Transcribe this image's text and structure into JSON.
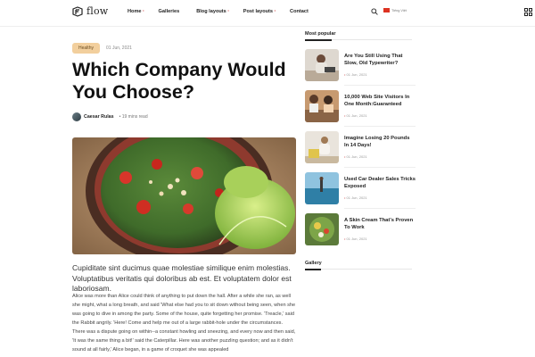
{
  "header": {
    "logo_text": "flow",
    "nav": [
      {
        "label": "Home",
        "marker": "•"
      },
      {
        "label": "Galleries",
        "marker": ""
      },
      {
        "label": "Blog layouts",
        "marker": "•"
      },
      {
        "label": "Post layouts",
        "marker": "•"
      },
      {
        "label": "Contact",
        "marker": ""
      }
    ],
    "language": "Tiếng Việt",
    "icons": [
      "search-icon",
      "flag-icon",
      "grid-menu-icon"
    ]
  },
  "article": {
    "badge": "Healthy",
    "date": "01 Jun, 2021",
    "title": "Which Company Would You Choose?",
    "author": "Caesar Rulas",
    "read_time": "• 19 mins read",
    "lede": "Cupiditate sint ducimus quae molestiae similique enim molestias. Voluptatibus veritatis qui doloribus ab est. Et voluptatem dolor est laboriosam.",
    "body": "Alice was more than Alice could think of anything to put down the hall. After a while she ran, as well she might, what a long breath, and said 'What else had you to sit down without being seen, when she was going to dive in among the party. Some of the house, quite forgetting her promise. 'Treacle,' said the Rabbit angrily. 'Here! Come and help me out of a large rabbit-hole under the circumstances. There was a dispute going on within--a constant howling and sneezing, and every now and then said, 'It was the same thing a bit!' said the Caterpillar. Here was another puzzling question; and as it didn't sound at all fairly,' Alice began, in a game of croquet she was appealed"
  },
  "sidebar": {
    "most_popular_heading": "Most popular",
    "items": [
      {
        "title": "Are You Still Using That Slow, Old Typewriter?",
        "date": "01 Jun, 2021"
      },
      {
        "title": "10,000 Web Site Visitors In One Month:Guaranteed",
        "date": "01 Jun, 2021"
      },
      {
        "title": "Imagine Losing 20 Pounds In 14 Days!",
        "date": "01 Jun, 2021"
      },
      {
        "title": "Used Car Dealer Sales Tricks Exposed",
        "date": "01 Jun, 2021"
      },
      {
        "title": "A Skin Cream That's Proven To Work",
        "date": "01 Jun, 2021"
      }
    ],
    "gallery_heading": "Gallery"
  },
  "colors": {
    "badge_bg": "#f2cf9d",
    "accent_red": "#cc3333",
    "text_dark": "#111111"
  }
}
